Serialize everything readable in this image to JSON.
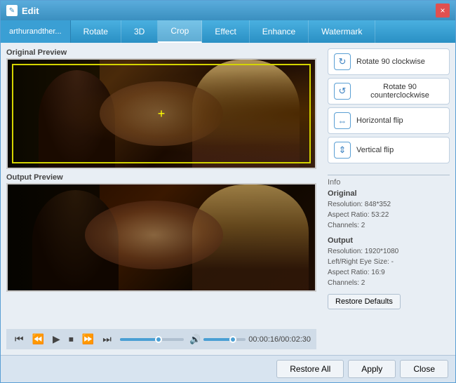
{
  "window": {
    "title": "Edit",
    "close_label": "×"
  },
  "file_tab": {
    "name": "arthurandther..."
  },
  "tabs": [
    {
      "id": "rotate",
      "label": "Rotate",
      "active": false
    },
    {
      "id": "3d",
      "label": "3D",
      "active": false
    },
    {
      "id": "crop",
      "label": "Crop",
      "active": true
    },
    {
      "id": "effect",
      "label": "Effect",
      "active": false
    },
    {
      "id": "enhance",
      "label": "Enhance",
      "active": false
    },
    {
      "id": "watermark",
      "label": "Watermark",
      "active": false
    }
  ],
  "preview": {
    "original_label": "Original Preview",
    "output_label": "Output Preview"
  },
  "controls": {
    "time_display": "00:00:16/00:02:30"
  },
  "actions": [
    {
      "id": "rotate-cw",
      "label": "Rotate 90 clockwise",
      "icon": "↻"
    },
    {
      "id": "rotate-ccw",
      "label": "Rotate 90 counterclockwise",
      "icon": "↺"
    },
    {
      "id": "h-flip",
      "label": "Horizontal flip",
      "icon": "⇔"
    },
    {
      "id": "v-flip",
      "label": "Vertical flip",
      "icon": "⇕"
    }
  ],
  "info": {
    "section_label": "Info",
    "original": {
      "label": "Original",
      "resolution": "Resolution: 848*352",
      "aspect_ratio": "Aspect Ratio: 53:22",
      "channels": "Channels: 2"
    },
    "output": {
      "label": "Output",
      "resolution": "Resolution: 1920*1080",
      "left_right": "Left/Right Eye Size: -",
      "aspect_ratio": "Aspect Ratio: 16:9",
      "channels": "Channels: 2"
    }
  },
  "buttons": {
    "restore_defaults": "Restore Defaults",
    "restore_all": "Restore All",
    "apply": "Apply",
    "close": "Close"
  }
}
